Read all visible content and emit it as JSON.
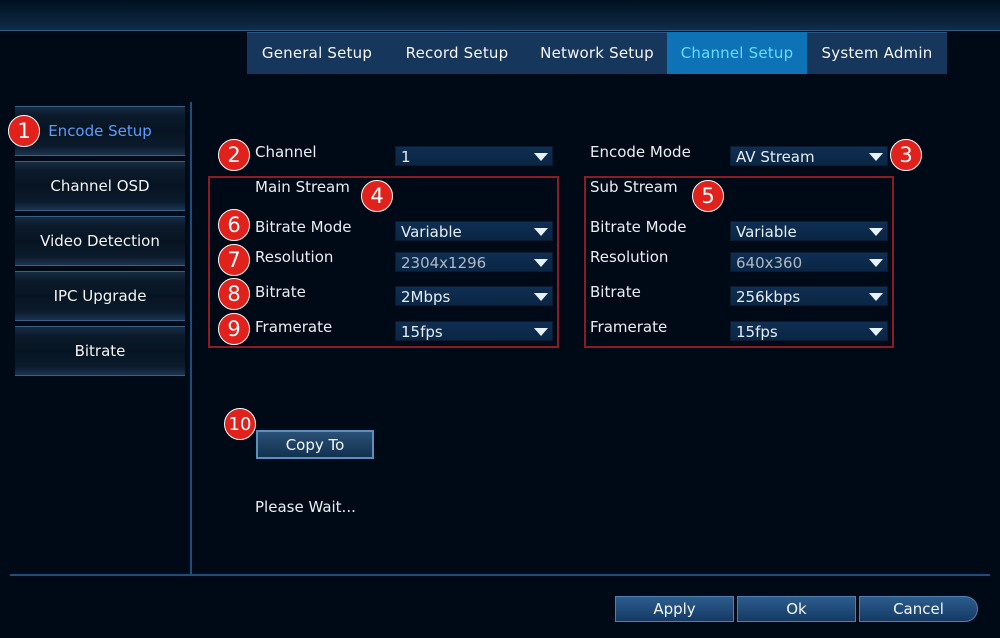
{
  "tabs": [
    "General Setup",
    "Record Setup",
    "Network Setup",
    "Channel Setup",
    "System Admin"
  ],
  "active_tab": "Channel Setup",
  "sidebar": [
    "Encode Setup",
    "Channel OSD",
    "Video Detection",
    "IPC Upgrade",
    "Bitrate"
  ],
  "active_sidebar": "Encode Setup",
  "channel": {
    "label": "Channel",
    "value": "1"
  },
  "encode_mode": {
    "label": "Encode Mode",
    "value": "AV Stream"
  },
  "main_stream": {
    "title": "Main Stream",
    "bitrate_mode": {
      "label": "Bitrate Mode",
      "value": "Variable"
    },
    "resolution": {
      "label": "Resolution",
      "value": "2304x1296"
    },
    "bitrate": {
      "label": "Bitrate",
      "value": "2Mbps"
    },
    "framerate": {
      "label": "Framerate",
      "value": "15fps"
    }
  },
  "sub_stream": {
    "title": "Sub Stream",
    "bitrate_mode": {
      "label": "Bitrate Mode",
      "value": "Variable"
    },
    "resolution": {
      "label": "Resolution",
      "value": "640x360"
    },
    "bitrate": {
      "label": "Bitrate",
      "value": "256kbps"
    },
    "framerate": {
      "label": "Framerate",
      "value": "15fps"
    }
  },
  "copy_to": "Copy To",
  "status": "Please Wait...",
  "buttons": {
    "apply": "Apply",
    "ok": "Ok",
    "cancel": "Cancel"
  },
  "callouts": [
    "1",
    "2",
    "3",
    "4",
    "5",
    "6",
    "7",
    "8",
    "9",
    "10"
  ]
}
